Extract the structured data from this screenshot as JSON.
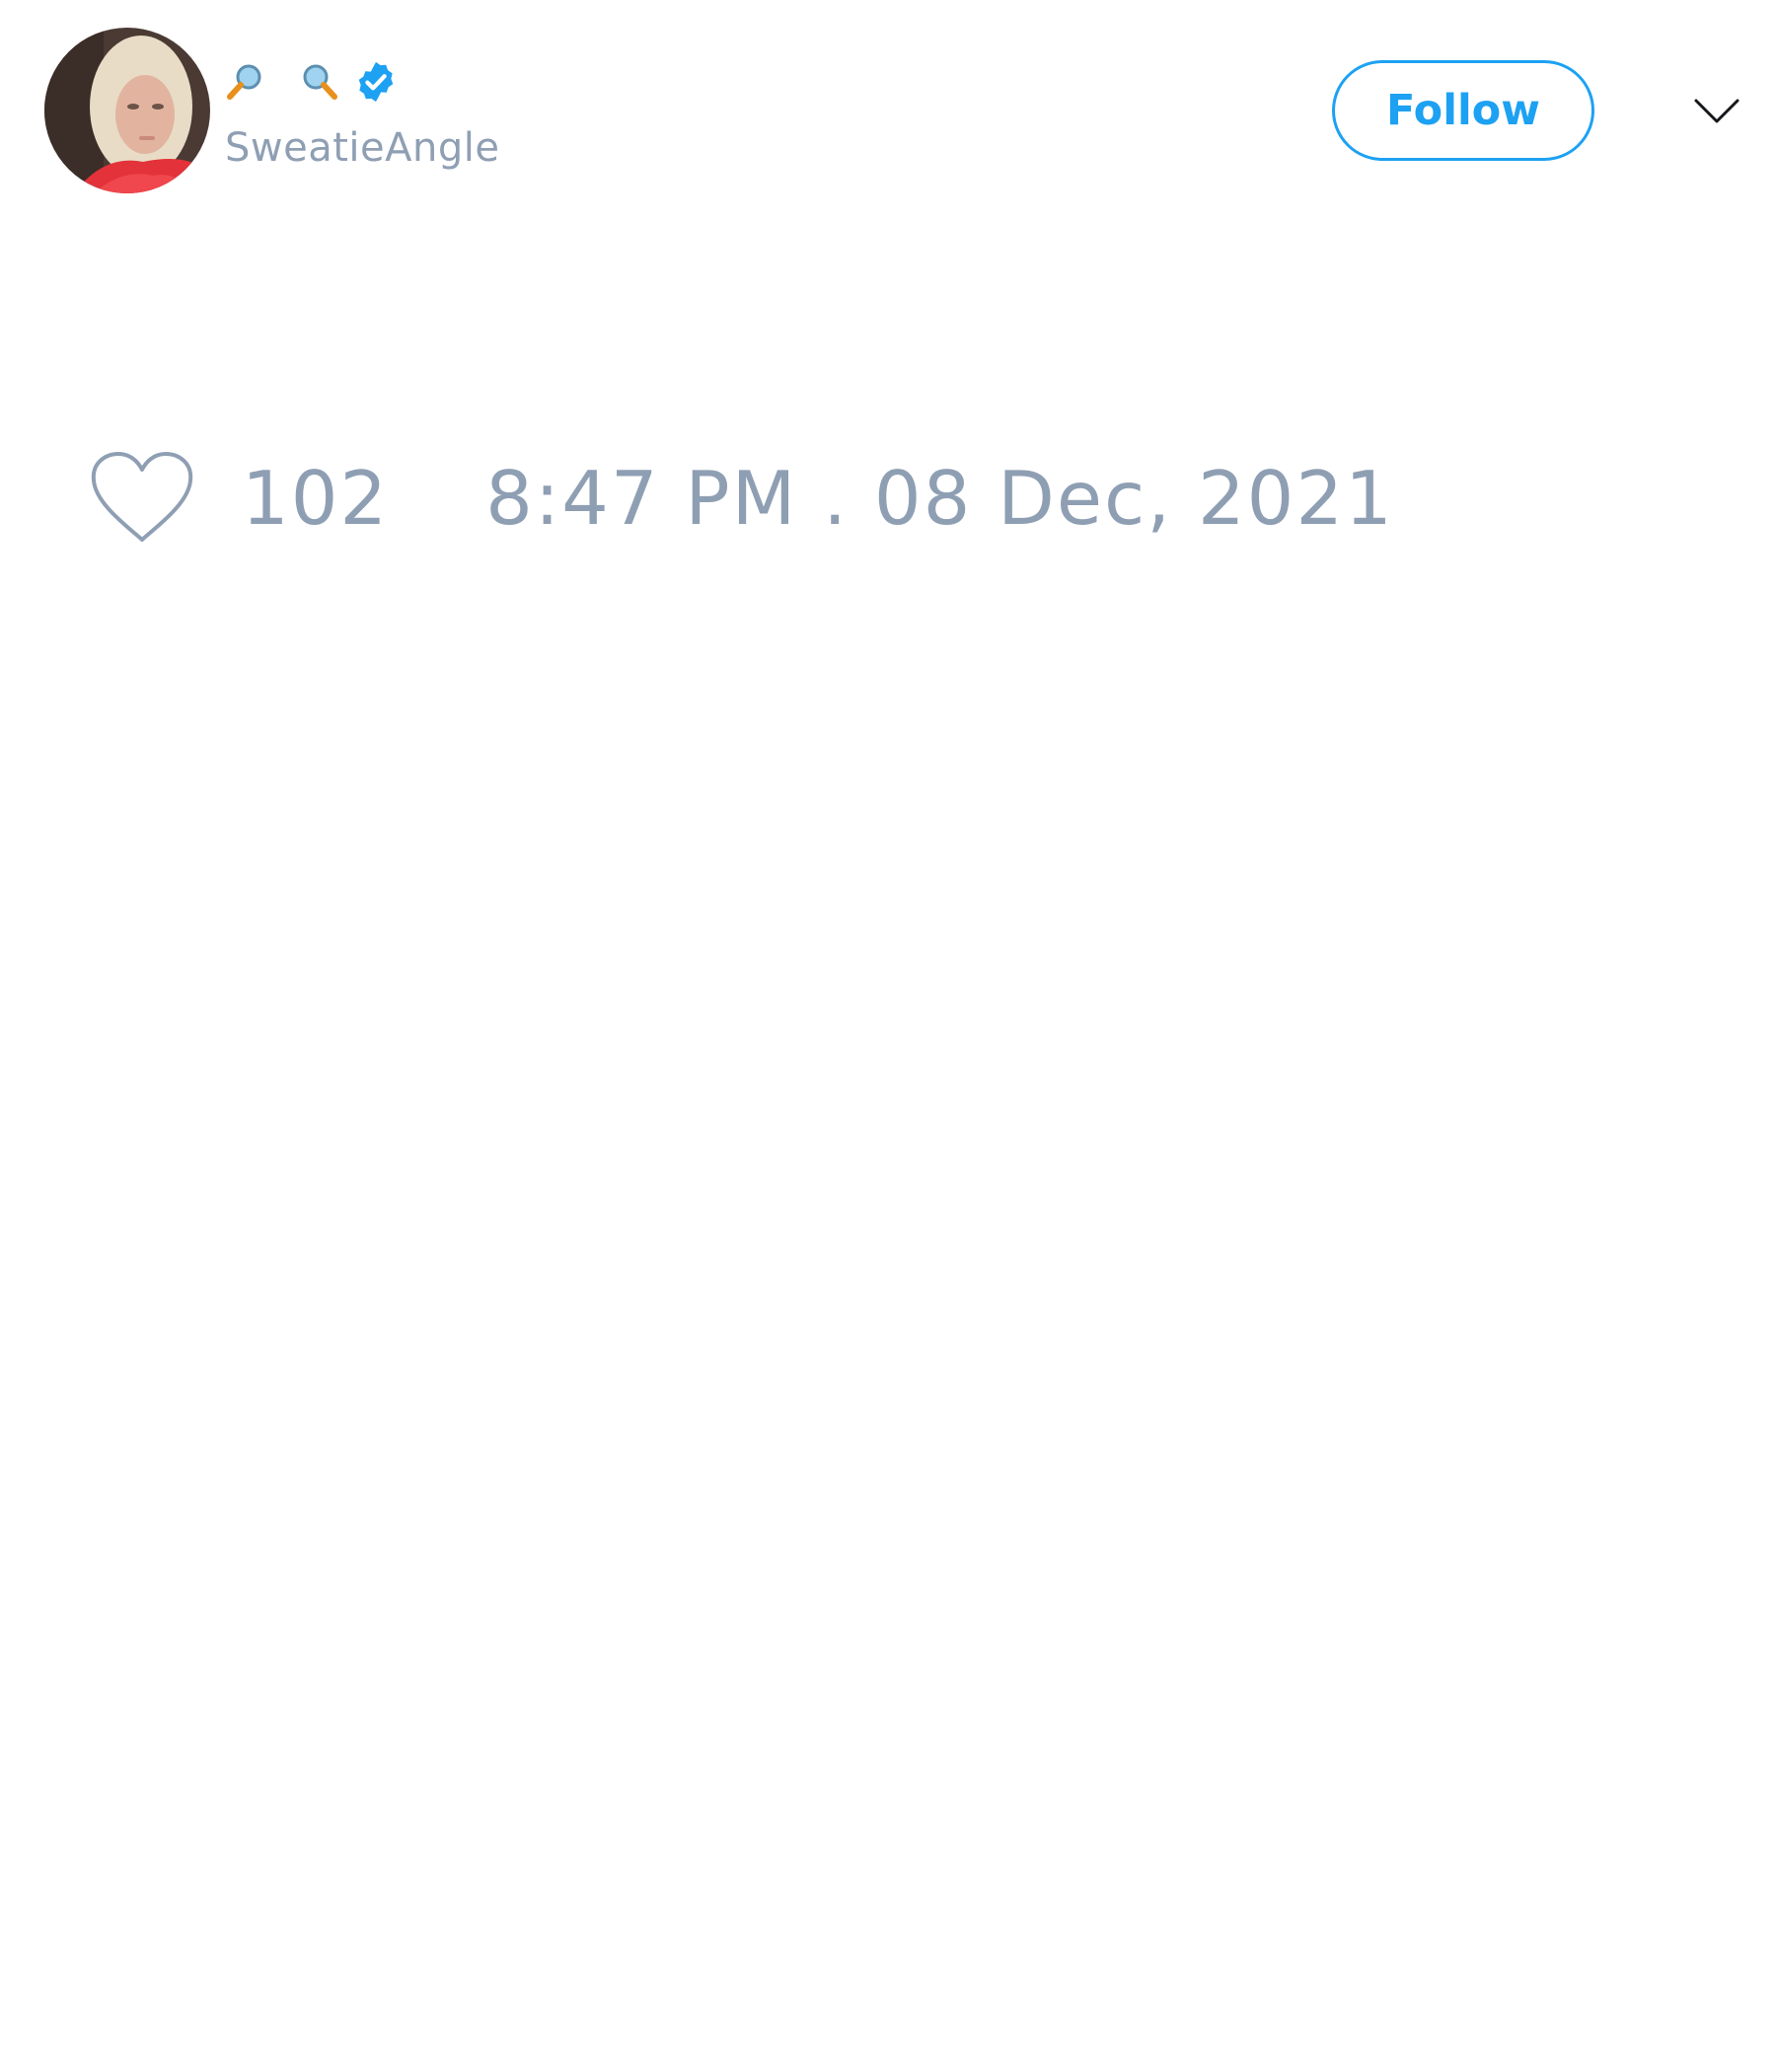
{
  "tweet": {
    "author": {
      "display_name_icons": [
        "magnifier-left-icon",
        "magnifier-right-icon"
      ],
      "verified": true,
      "handle": "SweatieAngle"
    },
    "follow_label": "Follow",
    "more_icon": "chevron-down-icon",
    "like_icon": "heart-outline-icon",
    "like_count": "102",
    "timestamp": "8:47 PM . 08 Dec, 2021"
  },
  "colors": {
    "accent": "#1da1f2",
    "muted_text": "#8f9fb3",
    "background": "#ffffff"
  }
}
